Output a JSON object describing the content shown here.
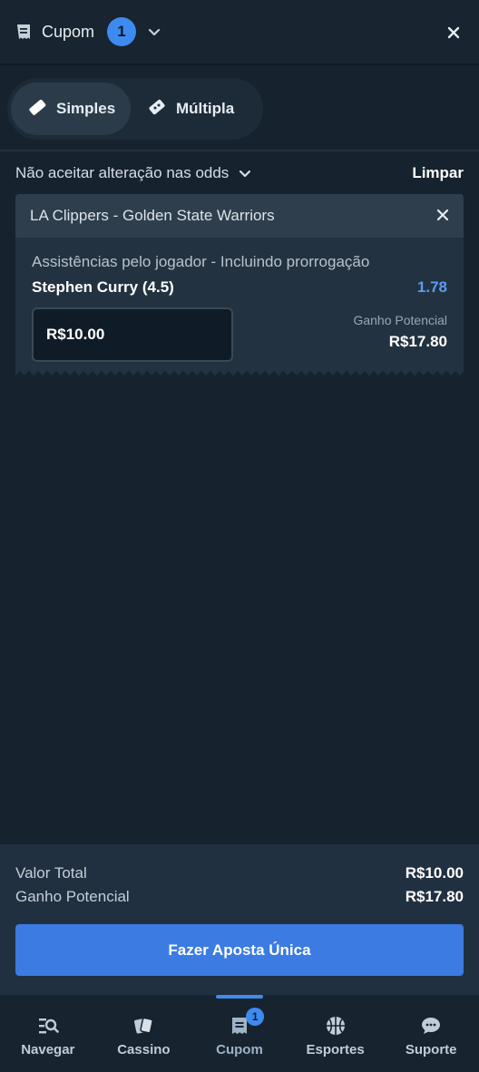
{
  "header": {
    "title": "Cupom",
    "count": "1",
    "icons": {
      "coupon": "receipt-icon",
      "expand": "chevron-down-icon",
      "close": "close-icon"
    }
  },
  "mode_tabs": [
    {
      "label": "Simples",
      "icon": "ticket-icon",
      "active": true
    },
    {
      "label": "Múltipla",
      "icon": "tickets-icon",
      "active": false
    }
  ],
  "options": {
    "odds_setting": "Não aceitar alteração nas odds",
    "clear_label": "Limpar"
  },
  "bet": {
    "event": "LA Clippers - Golden State Warriors",
    "market": "Assistências pelo jogador - Incluindo prorrogação",
    "selection": "Stephen Curry (4.5)",
    "odds": "1.78",
    "stake": "R$10.00",
    "potential_label": "Ganho Potencial",
    "potential_value": "R$17.80"
  },
  "summary": {
    "total_label": "Valor Total",
    "total_value": "R$10.00",
    "potential_label": "Ganho Potencial",
    "potential_value": "R$17.80",
    "place_bet_label": "Fazer Aposta Única"
  },
  "bottom_nav": [
    {
      "label": "Navegar",
      "icon": "browse-icon"
    },
    {
      "label": "Cassino",
      "icon": "cards-icon"
    },
    {
      "label": "Cupom",
      "icon": "coupon-icon",
      "badge": "1",
      "active": true
    },
    {
      "label": "Esportes",
      "icon": "basketball-icon"
    },
    {
      "label": "Suporte",
      "icon": "chat-icon"
    }
  ],
  "colors": {
    "background": "#16222e",
    "accent": "#3d8bf0",
    "button": "#3b7be2",
    "odds": "#5b9cf0"
  }
}
